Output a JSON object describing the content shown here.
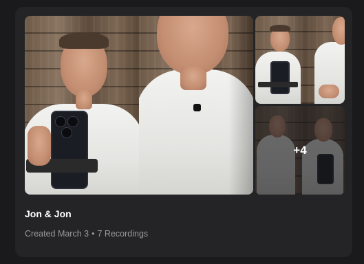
{
  "collection": {
    "title": "Jon & Jon",
    "created": "Created March 3",
    "separator": "•",
    "recordings": "7 Recordings",
    "more_count": "+4"
  },
  "thumbnails": [
    {
      "label": "recording-thumbnail-1"
    },
    {
      "label": "recording-thumbnail-2"
    },
    {
      "label": "recording-thumbnail-3"
    },
    {
      "label": "recording-thumbnail-4"
    }
  ],
  "colors": {
    "page_bg": "#1a1a1c",
    "card_bg": "#242426",
    "title": "#ffffff",
    "meta": "#9a9a9e"
  }
}
